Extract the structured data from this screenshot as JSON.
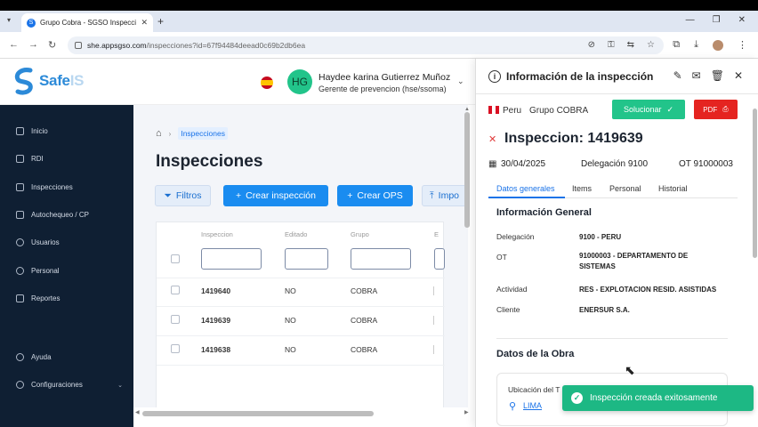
{
  "browser": {
    "tab_title": "Grupo Cobra - SGSO Inspecciones",
    "tab_icon": "S",
    "url_domain": "she.appsgso.com",
    "url_path": "/inspecciones?id=67f94484deead0c69b2db6ea"
  },
  "header": {
    "logo_text": "Safe",
    "logo_suffix": "IS",
    "avatar_initials": "HG",
    "user_name": "Haydee karina Gutierrez Muñoz",
    "user_role": "Gerente de prevencion (hse/ssoma)"
  },
  "sidebar": {
    "items": [
      {
        "label": "Inicio"
      },
      {
        "label": "RDI"
      },
      {
        "label": "Inspecciones"
      },
      {
        "label": "Autochequeo / CP"
      },
      {
        "label": "Usuarios"
      },
      {
        "label": "Personal"
      },
      {
        "label": "Reportes"
      },
      {
        "label": "Ayuda"
      },
      {
        "label": "Configuraciones"
      }
    ]
  },
  "main": {
    "breadcrumb": "Inspecciones",
    "title": "Inspecciones",
    "filter_label": "Filtros",
    "create_inspection_label": "Crear inspección",
    "create_ops_label": "Crear OPS",
    "import_label": "Impo",
    "columns": [
      "Inspeccion",
      "Editado",
      "Grupo",
      "E"
    ],
    "rows": [
      {
        "id": "1419640",
        "edited": "NO",
        "group": "COBRA"
      },
      {
        "id": "1419639",
        "edited": "NO",
        "group": "COBRA"
      },
      {
        "id": "1419638",
        "edited": "NO",
        "group": "COBRA"
      }
    ]
  },
  "panel": {
    "title": "Información de la inspección",
    "country": "Peru",
    "group": "Grupo COBRA",
    "solve_label": "Solucionar",
    "pdf_label": "PDF",
    "inspection_title": "Inspeccion: 1419639",
    "date": "30/04/2025",
    "delegation": "Delegación 9100",
    "ot": "OT 91000003",
    "tabs": [
      "Datos generales",
      "Items",
      "Personal",
      "Historial"
    ],
    "general_title": "Información General",
    "fields": [
      {
        "label": "Delegación",
        "value": "9100 - PERU"
      },
      {
        "label": "OT",
        "value": "91000003 - DEPARTAMENTO DE SISTEMAS"
      },
      {
        "label": "Actividad",
        "value": "RES - EXPLOTACION RESID. ASISTIDAS"
      },
      {
        "label": "Cliente",
        "value": "ENERSUR S.A."
      }
    ],
    "works_title": "Datos de la Obra",
    "location_label": "Ubicación del T",
    "location_value": "LIMA"
  },
  "toast": {
    "message": "Inspección creada exitosamente"
  },
  "colors": {
    "accent": "#1a8cf0",
    "sidebar_bg": "#0f1f33",
    "success": "#22c48a",
    "danger": "#e52420"
  }
}
